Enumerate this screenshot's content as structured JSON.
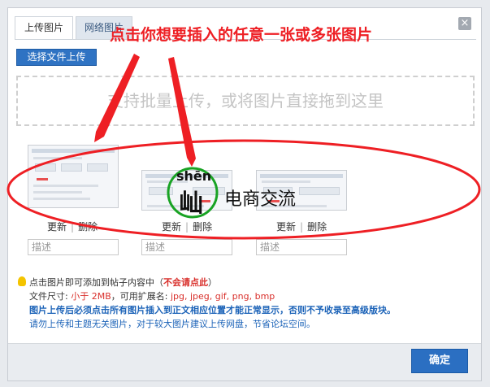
{
  "tabs": [
    {
      "label": "上传图片"
    },
    {
      "label": "网络图片"
    }
  ],
  "close_label": "×",
  "choose_button": "选择文件上传",
  "dropzone_text": "支持批量上传，或将图片直接拖到这里",
  "overlay_title": "点击你想要插入的任意一张或多张图片",
  "images": [
    {
      "update": "更新",
      "delete": "删除",
      "desc_placeholder": "描述"
    },
    {
      "update": "更新",
      "delete": "删除",
      "desc_placeholder": "描述"
    },
    {
      "update": "更新",
      "delete": "删除",
      "desc_placeholder": "描述"
    }
  ],
  "watermark": {
    "pinyin": "shēn",
    "char": "屾",
    "text": "电商交流"
  },
  "info": {
    "line1_a": "点击图片即可添加到帖子内容中（",
    "line1_b": "不会请点此",
    "line1_c": "）",
    "line2_a": "文件尺寸: ",
    "line2_b": "小于 2MB",
    "line2_c": "，可用扩展名: ",
    "line2_d": "jpg, jpeg, gif, png, bmp",
    "line3": "图片上传后必须点击所有图片插入到正文相应位置才能正常显示，否则不予收录至高级版块。",
    "line4": "请勿上传和主题无关图片，对于较大图片建议上传网盘，节省论坛空间。"
  },
  "ok_button": "确定",
  "colors": {
    "accent": "#2f73c3",
    "annotation_red": "#ee1f24",
    "circle_green": "#19a324"
  }
}
